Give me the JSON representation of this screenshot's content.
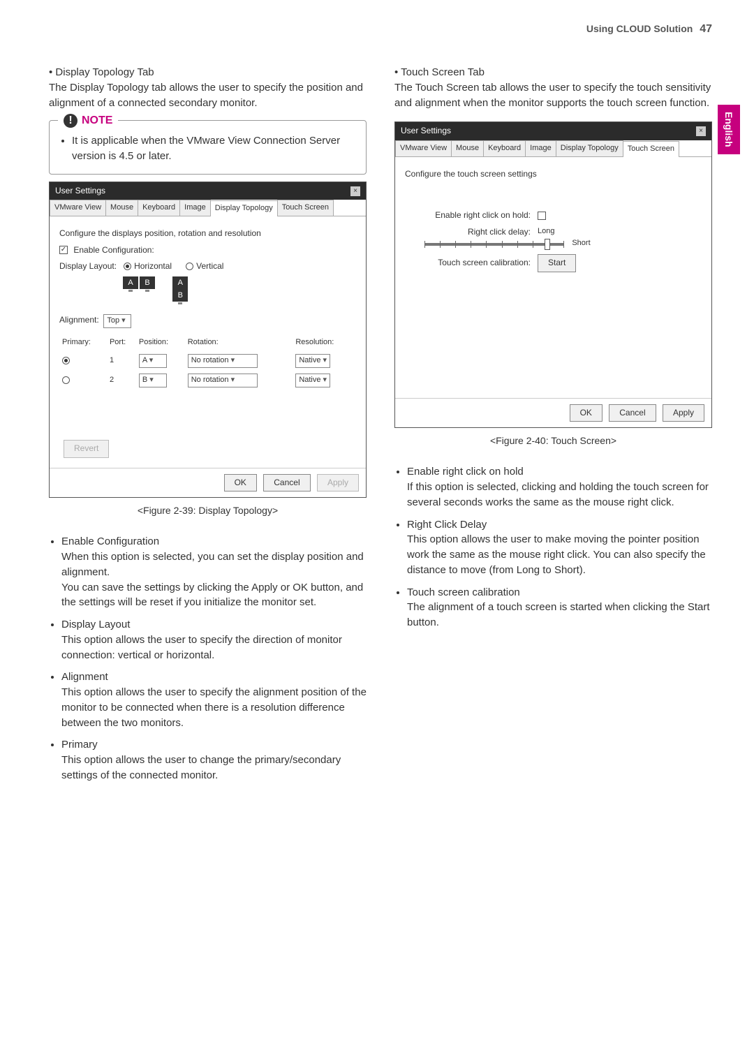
{
  "header": {
    "section": "Using CLOUD Solution",
    "page": "47"
  },
  "side_tab": "English",
  "left": {
    "head": "Display Topology Tab",
    "intro": "The Display Topology tab allows the user to specify the position and alignment of a connected secondary monitor.",
    "note_label": "NOTE",
    "note_item": "It is applicable when the VMware View Connection Server version is 4.5 or later.",
    "dlg_title": "User Settings",
    "tabs": [
      "VMware View",
      "Mouse",
      "Keyboard",
      "Image",
      "Display Topology",
      "Touch Screen"
    ],
    "body_top": "Configure the displays position, rotation and resolution",
    "enable_cfg": "Enable Configuration:",
    "display_layout_lbl": "Display Layout:",
    "horizontal": "Horizontal",
    "vertical": "Vertical",
    "monA": "A",
    "monB": "B",
    "alignment_lbl": "Alignment:",
    "alignment_val": "Top",
    "th_primary": "Primary:",
    "th_port": "Port:",
    "th_position": "Position:",
    "th_rotation": "Rotation:",
    "th_resolution": "Resolution:",
    "port1": "1",
    "port2": "2",
    "posA": "A",
    "posB": "B",
    "norot": "No rotation",
    "native": "Native",
    "revert": "Revert",
    "ok": "OK",
    "cancel": "Cancel",
    "apply": "Apply",
    "caption": "<Figure 2-39: Display Topology>",
    "pt_enable_h": "Enable Configuration",
    "pt_enable_b1": "When this option is selected, you can set the display position and alignment.",
    "pt_enable_b2": "You can save the settings by clicking the Apply or OK button, and the settings will be reset if you initialize the monitor set.",
    "pt_layout_h": "Display Layout",
    "pt_layout_b": "This option allows the user to specify the direction of monitor connection: vertical or horizontal.",
    "pt_align_h": "Alignment",
    "pt_align_b": "This option allows the user to specify the alignment position of the monitor to be connected when there is a resolution difference between the two monitors.",
    "pt_primary_h": "Primary",
    "pt_primary_b": "This option allows the user to change the primary/secondary settings of the connected monitor."
  },
  "right": {
    "head": "Touch Screen Tab",
    "intro": "The Touch Screen tab allows the user to specify the touch sensitivity and alignment when the monitor supports the touch screen function.",
    "dlg_title": "User Settings",
    "tabs": [
      "VMware View",
      "Mouse",
      "Keyboard",
      "Image",
      "Display Topology",
      "Touch Screen"
    ],
    "body_top": "Configure the touch screen settings",
    "lbl_enable": "Enable right click on hold:",
    "lbl_delay": "Right click delay:",
    "delay_long": "Long",
    "delay_short": "Short",
    "lbl_calib": "Touch screen calibration:",
    "start": "Start",
    "ok": "OK",
    "cancel": "Cancel",
    "apply": "Apply",
    "caption": "<Figure 2-40: Touch Screen>",
    "pt_enable_h": "Enable right click on hold",
    "pt_enable_b": "If this option is selected, clicking and holding the touch screen for several seconds works the same as the mouse right click.",
    "pt_delay_h": "Right Click Delay",
    "pt_delay_b": "This option allows the user to make moving the pointer position work the same as the mouse right click. You can also specify the distance to move (from Long to Short).",
    "pt_calib_h": "Touch screen calibration",
    "pt_calib_b": "The alignment of a touch screen is started when clicking the Start button."
  }
}
